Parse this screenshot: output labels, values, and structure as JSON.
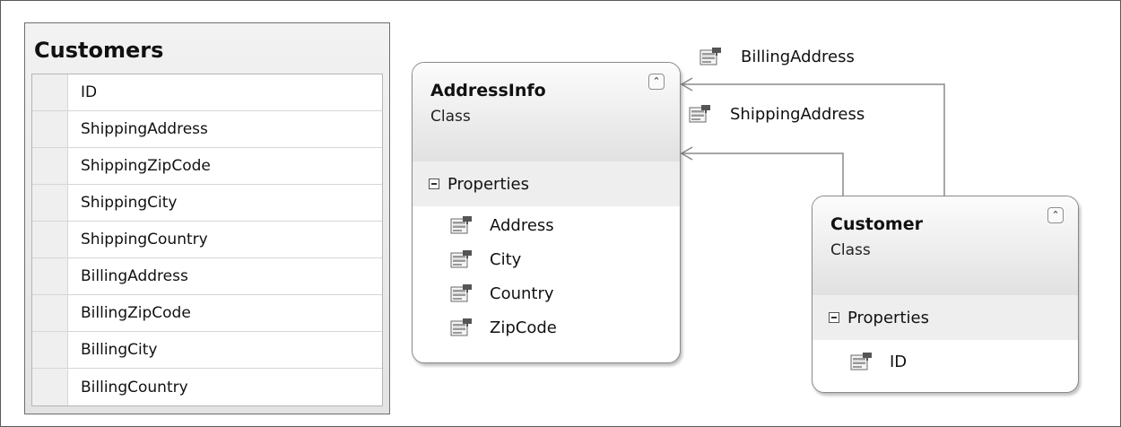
{
  "table": {
    "title": "Customers",
    "columns": [
      "ID",
      "ShippingAddress",
      "ShippingZipCode",
      "ShippingCity",
      "ShippingCountry",
      "BillingAddress",
      "BillingZipCode",
      "BillingCity",
      "BillingCountry"
    ]
  },
  "address_class": {
    "name": "AddressInfo",
    "stereotype": "Class",
    "section": "Properties",
    "properties": [
      "Address",
      "City",
      "Country",
      "ZipCode"
    ],
    "collapse_icon": "double-chevron-up-icon"
  },
  "customer_class": {
    "name": "Customer",
    "stereotype": "Class",
    "section": "Properties",
    "properties": [
      "ID"
    ],
    "collapse_icon": "double-chevron-up-icon"
  },
  "associations": {
    "billing": "BillingAddress",
    "shipping": "ShippingAddress"
  },
  "icons": {
    "property": "property-icon"
  },
  "colors": {
    "border": "#8a8a8a",
    "header_gradient_top": "#fcfcfc",
    "header_gradient_bottom": "#e1e1e1",
    "section_bg": "#eeeeee"
  }
}
